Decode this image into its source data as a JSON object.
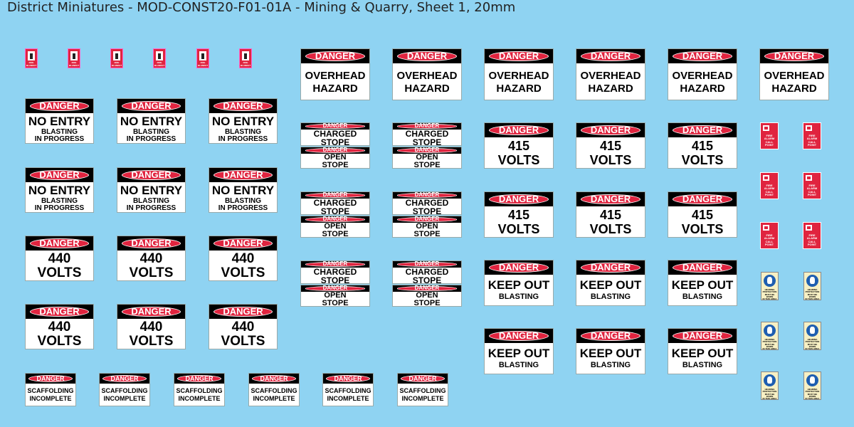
{
  "title": "District Miniatures - MOD-CONST20-F01-01A - Mining & Quarry, Sheet 1, 20mm",
  "labels": {
    "danger": "DANGER",
    "no_entry": "NO ENTRY",
    "blasting_in_progress_1": "BLASTING",
    "blasting_in_progress_2": "IN PROGRESS",
    "v440_1": "440",
    "v440_2": "VOLTS",
    "v415_1": "415",
    "v415_2": "VOLTS",
    "overhead": "OVERHEAD",
    "hazard": "HAZARD",
    "charged": "CHARGED",
    "stope": "STOPE",
    "open": "OPEN",
    "keep_out": "KEEP OUT",
    "blasting": "BLASTING",
    "scaffolding": "SCAFFOLDING",
    "incomplete": "INCOMPLETE",
    "fire_blanket": "FIRE BLANKET",
    "fire_alarm_1": "FIRE",
    "fire_alarm_2": "ALARM",
    "fire_alarm_3": "CALL POINT",
    "hearing_1": "HEARING",
    "hearing_2": "PROTECTION",
    "hearing_3": "MUST BE WORN",
    "hearing_4": "IN THIS AREA"
  },
  "colors": {
    "background": "#8fd3f2",
    "danger_red": "#e0243f",
    "header_black": "#000000",
    "sign_white": "#ffffff"
  },
  "icons": {
    "fire_blanket": "fire-blanket-pictogram",
    "fire_alarm": "fire-alarm-call-point-pictogram",
    "hearing": "ear-protection-pictogram"
  }
}
